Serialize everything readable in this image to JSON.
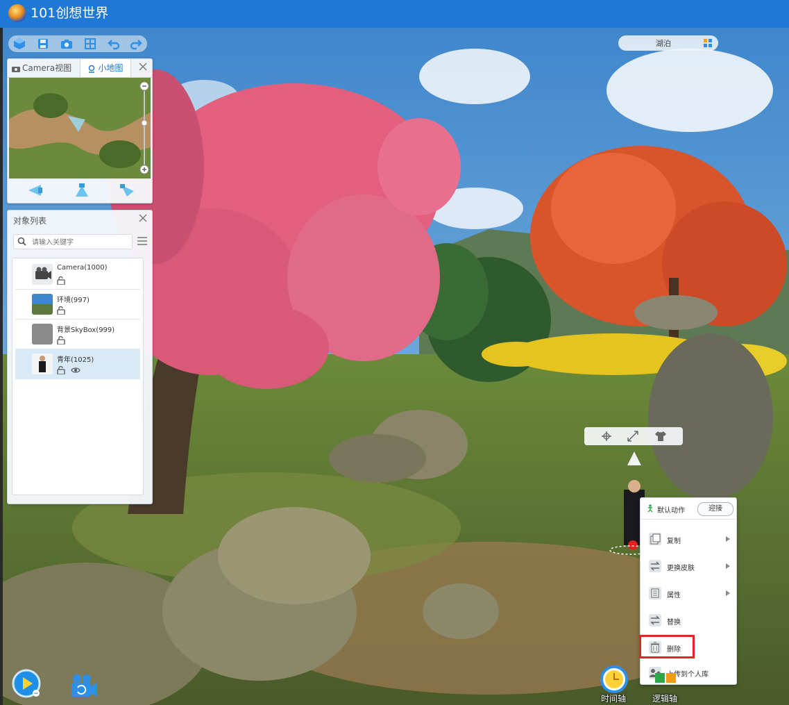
{
  "app": {
    "title": "101创想世界"
  },
  "filter": {
    "label": "湖泊"
  },
  "minimap_panel": {
    "tabs": [
      {
        "label": "Camera视图"
      },
      {
        "label": "小地图"
      }
    ]
  },
  "object_list": {
    "title": "对象列表",
    "search_placeholder": "请输入关键字",
    "items": [
      {
        "name": "Camera(1000)"
      },
      {
        "name": "环境(997)"
      },
      {
        "name": "背景SkyBox(999)"
      },
      {
        "name": "青年(1025)"
      }
    ]
  },
  "context_menu": {
    "header_label": "默认动作",
    "header_action": "迎接",
    "items": [
      {
        "label": "复制"
      },
      {
        "label": "更换皮肤"
      },
      {
        "label": "属性"
      },
      {
        "label": "替换"
      },
      {
        "label": "删除"
      },
      {
        "label": "上传到个人库"
      }
    ]
  },
  "bottom_bar": {
    "timeline_label": "时间轴",
    "logic_label": "逻辑轴"
  },
  "colors": {
    "title_bar": "#1e78d6",
    "accent": "#1e78d6",
    "highlight": "#e52525"
  }
}
